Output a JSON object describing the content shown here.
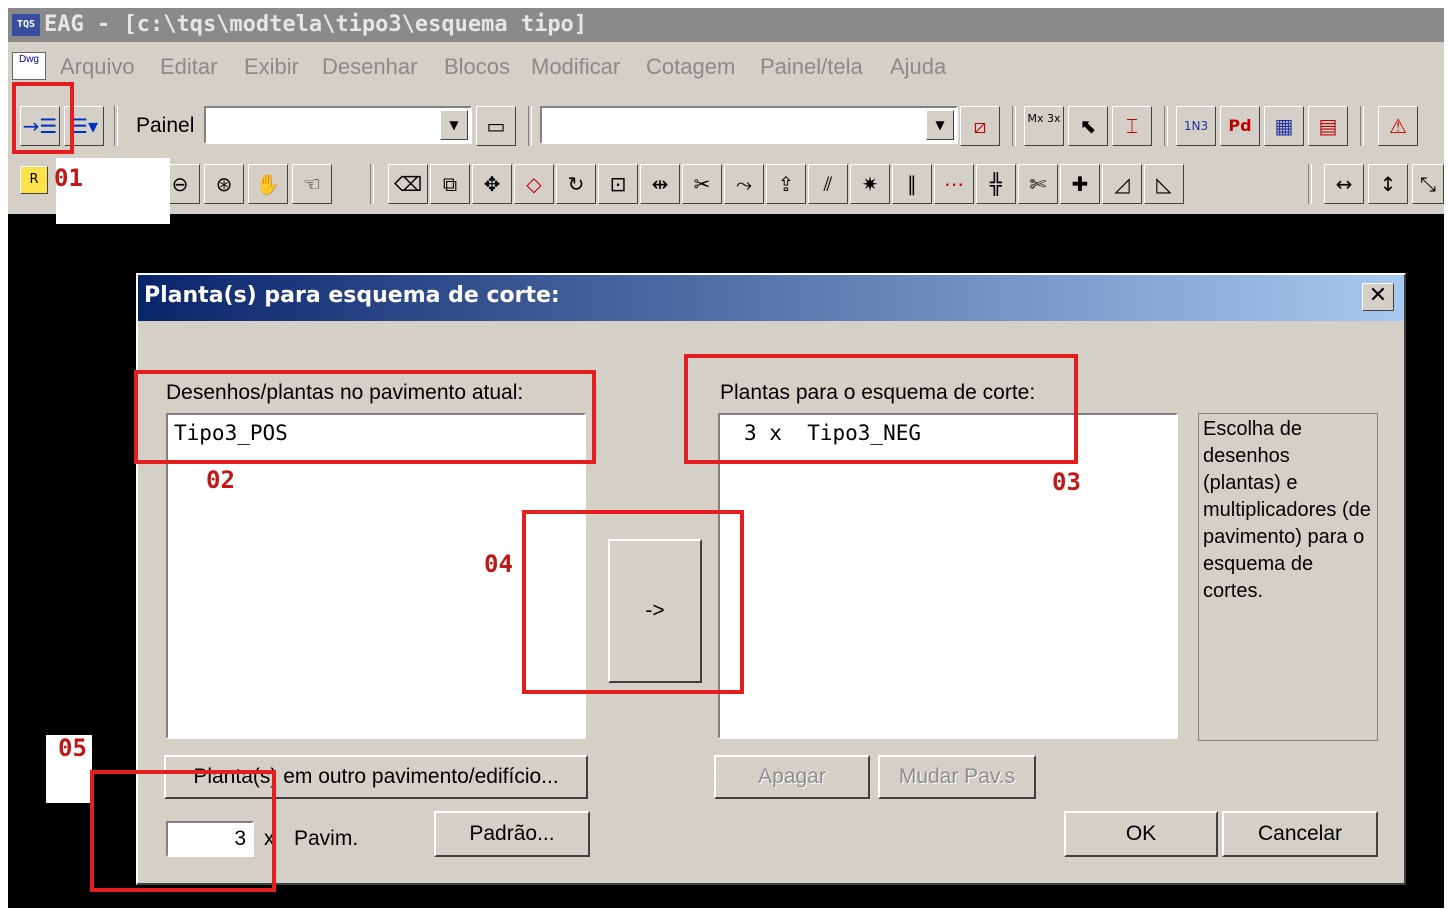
{
  "window": {
    "title": "EAG - [c:\\tqs\\modtela\\tipo3\\esquema tipo]"
  },
  "menu": [
    "Arquivo",
    "Editar",
    "Exibir",
    "Desenhar",
    "Blocos",
    "Modificar",
    "Cotagem",
    "Painel/tela",
    "Ajuda"
  ],
  "toolbar": {
    "painel_label": "Painel",
    "painel_value": "",
    "layer_value": "",
    "mx_label": "Mx 3x",
    "n_label": "1N3",
    "pd_label": "Pd",
    "r_label": "R"
  },
  "dialog": {
    "title": "Planta(s) para esquema de corte:",
    "left_label": "Desenhos/plantas no pavimento atual:",
    "left_items": [
      "Tipo3_POS"
    ],
    "right_label": "Plantas para o esquema de corte:",
    "right_items": [
      "3 x  Tipo3_NEG"
    ],
    "move_button": "->",
    "hint": "Escolha de desenhos (plantas) e multiplicadores (de pavimento) para o esquema de cortes.",
    "other_floor_button": "Planta(s) em outro pavimento/edifício...",
    "delete_button": "Apagar",
    "change_floor_button": "Mudar Pav.s",
    "multiplier_value": "3",
    "multiplier_x": "x",
    "pavim_label": "Pavim.",
    "default_button": "Padrão...",
    "ok_button": "OK",
    "cancel_button": "Cancelar"
  },
  "annotations": {
    "a01": "01",
    "a02": "02",
    "a03": "03",
    "a04": "04",
    "a05": "05"
  },
  "colors": {
    "annotation_red": "#e41e1e",
    "titlebar_blue": "#0a246a",
    "face": "#d4d0c8"
  }
}
